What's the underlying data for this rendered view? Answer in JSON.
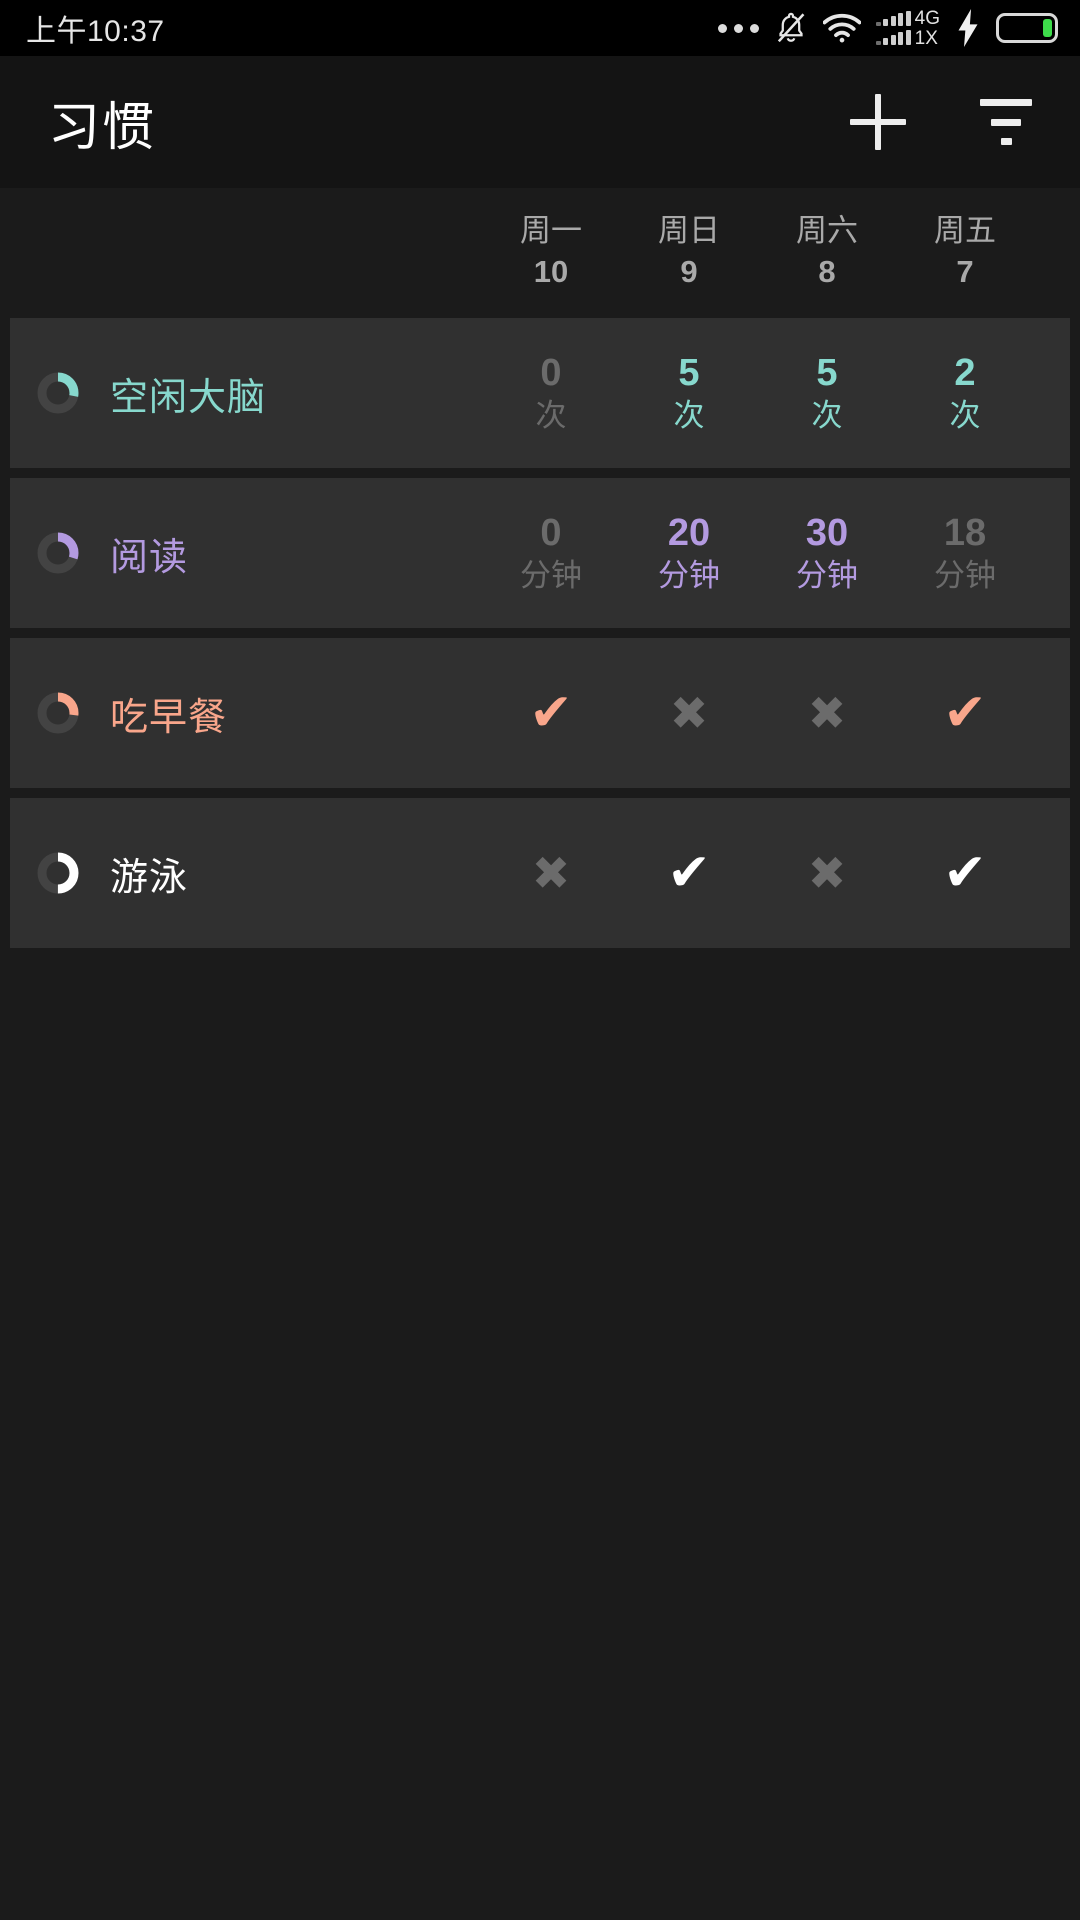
{
  "statusbar": {
    "clock": "上午10:37",
    "icons": [
      "more-dots",
      "bell-muted",
      "wifi",
      "signal-4g-1x",
      "charging-bolt",
      "battery"
    ],
    "network_primary": "4G",
    "network_secondary": "1X"
  },
  "appbar": {
    "title": "习惯",
    "add_label": "+",
    "filter_label": "filter"
  },
  "colors": {
    "page_bg": "#1b1b1b",
    "card_bg": "#303030",
    "appbar_bg": "#141414",
    "dim_text": "#6b6b6b",
    "header_text": "#a9a9a9",
    "teal": "#87d8cd",
    "purple": "#b39ae0",
    "salmon": "#f9a68b",
    "white": "#ffffff",
    "battery_green": "#3ddc4a"
  },
  "days": [
    {
      "dow": "周一",
      "num": "10"
    },
    {
      "dow": "周日",
      "num": "9"
    },
    {
      "dow": "周六",
      "num": "8"
    },
    {
      "dow": "周五",
      "num": "7"
    }
  ],
  "habits": [
    {
      "name": "空闲大脑",
      "color": "#87d8cd",
      "ring_pct": 28,
      "type": "numeric",
      "cells": [
        {
          "num": "0",
          "unit": "次",
          "dim": true
        },
        {
          "num": "5",
          "unit": "次",
          "dim": false
        },
        {
          "num": "5",
          "unit": "次",
          "dim": false
        },
        {
          "num": "2",
          "unit": "次",
          "dim": false
        }
      ]
    },
    {
      "name": "阅读",
      "color": "#b39ae0",
      "ring_pct": 30,
      "type": "numeric",
      "cells": [
        {
          "num": "0",
          "unit": "分钟",
          "dim": true
        },
        {
          "num": "20",
          "unit": "分钟",
          "dim": false
        },
        {
          "num": "30",
          "unit": "分钟",
          "dim": false
        },
        {
          "num": "18",
          "unit": "分钟",
          "dim": true
        }
      ]
    },
    {
      "name": "吃早餐",
      "color": "#f9a68b",
      "ring_pct": 27,
      "type": "boolean",
      "cells": [
        {
          "mark": "✔",
          "dim": false
        },
        {
          "mark": "✖",
          "dim": true
        },
        {
          "mark": "✖",
          "dim": true
        },
        {
          "mark": "✔",
          "dim": false
        }
      ]
    },
    {
      "name": "游泳",
      "color": "#ffffff",
      "ring_pct": 50,
      "type": "boolean",
      "cells": [
        {
          "mark": "✖",
          "dim": true
        },
        {
          "mark": "✔",
          "dim": false
        },
        {
          "mark": "✖",
          "dim": true
        },
        {
          "mark": "✔",
          "dim": false
        }
      ]
    }
  ]
}
